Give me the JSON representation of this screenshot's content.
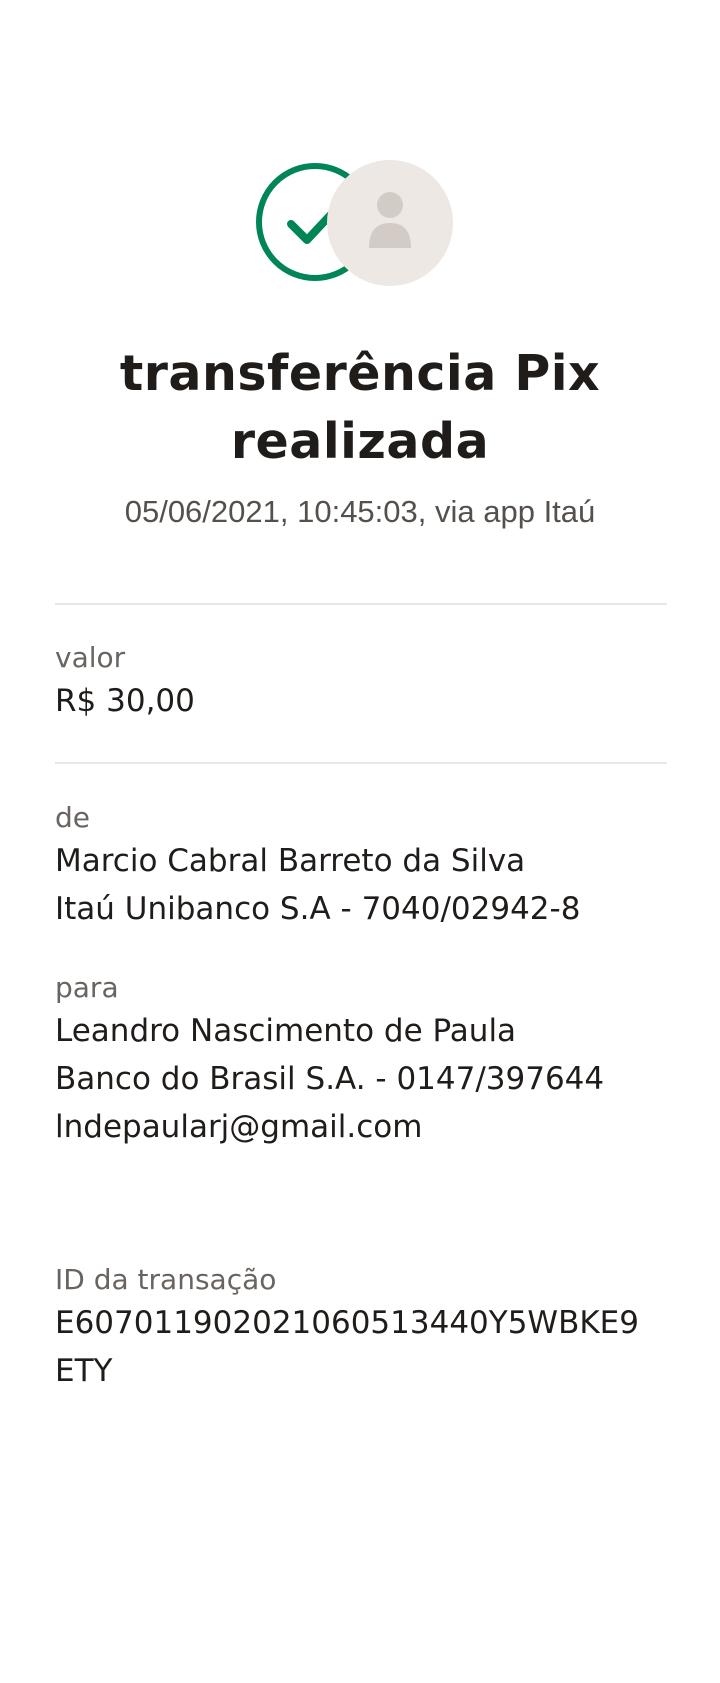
{
  "header": {
    "title_line1": "transferência Pix",
    "title_line2": "realizada",
    "subtitle": "05/06/2021,  10:45:03, via app Itaú"
  },
  "icons": {
    "status": "check-circle-icon",
    "recipient": "user-avatar-icon"
  },
  "colors": {
    "success_green": "#008556",
    "avatar_bg": "#ede8e4",
    "avatar_fg": "#d3ccc6",
    "divider": "#e9e6e3"
  },
  "amount": {
    "label": "valor",
    "value": "R$ 30,00"
  },
  "sender": {
    "label": "de",
    "name": "Marcio Cabral Barreto da Silva",
    "bank": "Itaú Unibanco S.A - 7040/02942-8"
  },
  "recipient": {
    "label": "para",
    "name": "Leandro Nascimento de Paula",
    "bank": "Banco do Brasil S.A. - 0147/397644",
    "email": "lndepaularj@gmail.com"
  },
  "transaction": {
    "label": "ID da transação",
    "id_line1": "E607011902021060513440Y5WBKE9",
    "id_line2": "ETY"
  }
}
